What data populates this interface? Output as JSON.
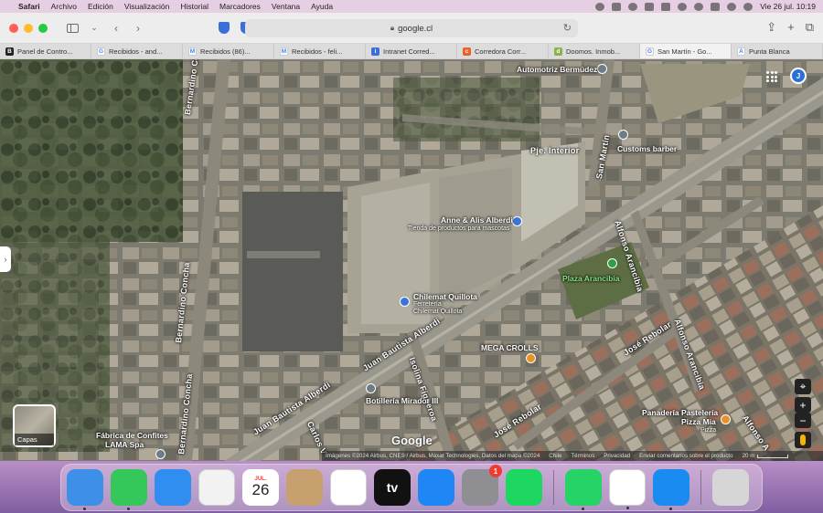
{
  "menubar": {
    "apple": "",
    "app": "Safari",
    "items": [
      "Archivo",
      "Edición",
      "Visualización",
      "Historial",
      "Marcadores",
      "Ventana",
      "Ayuda"
    ],
    "datetime": "Vie 26 jul.  10:19"
  },
  "toolbar": {
    "url": "google.cl"
  },
  "tabs": [
    {
      "label": "Panel de Contro...",
      "fav": "B",
      "color": "#222222"
    },
    {
      "label": "Recibidos - and...",
      "fav": "G",
      "color": "#ffffff"
    },
    {
      "label": "Recibidos (86)...",
      "fav": "M",
      "color": "#ffffff"
    },
    {
      "label": "Recibidos - feli...",
      "fav": "M",
      "color": "#ffffff"
    },
    {
      "label": "Intranet Corred...",
      "fav": "i",
      "color": "#3a6fd8"
    },
    {
      "label": "Corredora Corr...",
      "fav": "c",
      "color": "#e8622a"
    },
    {
      "label": "Doomos. Inmob...",
      "fav": "d",
      "color": "#8bb24a"
    },
    {
      "label": "San Martín - Go...",
      "fav": "G",
      "color": "#ffffff",
      "active": true
    },
    {
      "label": "Punta Blanca",
      "fav": "A",
      "color": "#ffffff"
    }
  ],
  "map": {
    "layers_label": "Capas",
    "logo": "Google",
    "attribution": {
      "imagery": "Imágenes ©2024 Airbus, CNES / Airbus, Maxar Technologies, Datos del mapa ©2024",
      "country": "Chile",
      "terms": "Términos",
      "privacy": "Privacidad",
      "feedback": "Enviar comentarios sobre el producto",
      "scale": "20 m"
    },
    "streets": {
      "bernardino_1": "Bernardino Concha",
      "bernardino_2": "Bernardino Concha",
      "bernardino_3": "Bernardino Concha",
      "juan_1": "Juan Bautista Alberdi",
      "juan_2": "Juan Bautista Alberdi",
      "juan_3": "Juan Bautista Alberdi",
      "pje_interior": "Pje. Interior",
      "san_martin": "San Martín",
      "alfonso_1": "Alfonso Arancibia",
      "alfonso_2": "Alfonso Arancibia",
      "alfonso_3": "Alfonso A",
      "jose_1": "José Rebolar",
      "jose_2": "José Rebolar",
      "isolina": "Isolina Figueroa",
      "carlos": "Carlos V"
    },
    "places": {
      "automotriz": "Automotriz Bermúdez",
      "customs": "Customs barber",
      "anne": "Anne & Alis Alberdi",
      "anne_sub": "Tienda de productos para mascotas",
      "chilemat": "Chilemat Quillota",
      "chilemat_sub1": "Ferretería",
      "chilemat_sub2": "Chilemat Quillota",
      "plaza": "Plaza Arancibia",
      "megacrolls": "MEGA CROLLS",
      "botilleria": "Botillería Mirador III",
      "panaderia": "Panadería Pastelería",
      "panaderia_2": "Pizza Mia",
      "panaderia_3": "Pizza",
      "fabrica": "Fábrica de Confites",
      "fabrica_2": "LAMA Spa"
    },
    "avatar": "J",
    "zoom_in": "+",
    "zoom_out": "−"
  },
  "dock": {
    "apps": [
      {
        "name": "Finder",
        "icon": "finder-icon",
        "color": "#3d8fe8",
        "running": true
      },
      {
        "name": "Messages",
        "icon": "messages-icon",
        "color": "#35c759",
        "running": true
      },
      {
        "name": "Mail",
        "icon": "mail-icon",
        "color": "#2f8ef0",
        "running": false
      },
      {
        "name": "Photos",
        "icon": "photos-icon",
        "color": "#f2f2f2",
        "running": false
      },
      {
        "name": "Calendar",
        "icon": "calendar-icon",
        "month": "JUL.",
        "day": "26",
        "running": false
      },
      {
        "name": "Contacts",
        "icon": "contacts-icon",
        "color": "#c8a070",
        "running": false
      },
      {
        "name": "Reminders",
        "icon": "reminders-icon",
        "color": "#ffffff",
        "running": false
      },
      {
        "name": "Apple TV",
        "icon": "tv-icon",
        "color": "#111111",
        "label": "tv",
        "running": false
      },
      {
        "name": "App Store",
        "icon": "app-store-icon",
        "color": "#1f86f5",
        "running": false
      },
      {
        "name": "System Settings",
        "icon": "settings-icon",
        "color": "#8e8e93",
        "badge": "1",
        "running": false
      },
      {
        "name": "Spotify",
        "icon": "spotify-icon",
        "color": "#1ed760",
        "running": false
      },
      {
        "name": "WhatsApp",
        "icon": "whatsapp-icon",
        "color": "#25d366",
        "running": true
      },
      {
        "name": "Chrome",
        "icon": "chrome-icon",
        "color": "#ffffff",
        "running": true
      },
      {
        "name": "Safari",
        "icon": "safari-icon",
        "color": "#1a8bf0",
        "running": true
      },
      {
        "name": "Trash",
        "icon": "trash-icon",
        "color": "#d6d6d6",
        "running": false
      }
    ]
  }
}
